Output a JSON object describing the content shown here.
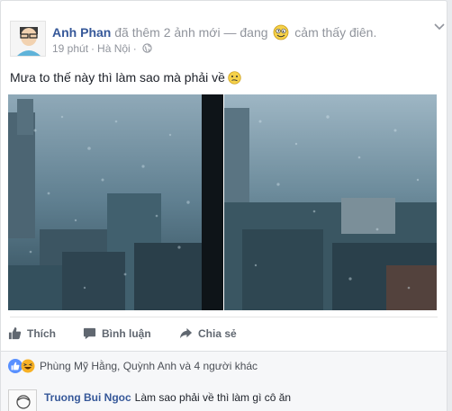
{
  "post": {
    "author": "Anh Phan",
    "activity": "đã thêm 2 ảnh mới — đang",
    "feeling": "cảm thấy điên.",
    "time": "19 phút",
    "location": "Hà Nội",
    "text": "Mưa to thế này thì làm sao mà phải về",
    "photo_count": 2
  },
  "actions": {
    "like": "Thích",
    "comment": "Bình luận",
    "share": "Chia sẻ"
  },
  "reactions": {
    "summary": "Phùng Mỹ Hằng, Quỳnh Anh và 4 người khác",
    "types": [
      "like",
      "haha"
    ]
  },
  "comment": {
    "author": "Truong Bui Ngoc",
    "text": "Làm sao phải về thì làm gì cô ăn"
  },
  "colors": {
    "link": "#365899",
    "meta": "#90949c",
    "like_blue": "#5890ff",
    "haha_yellow": "#f7b125"
  }
}
